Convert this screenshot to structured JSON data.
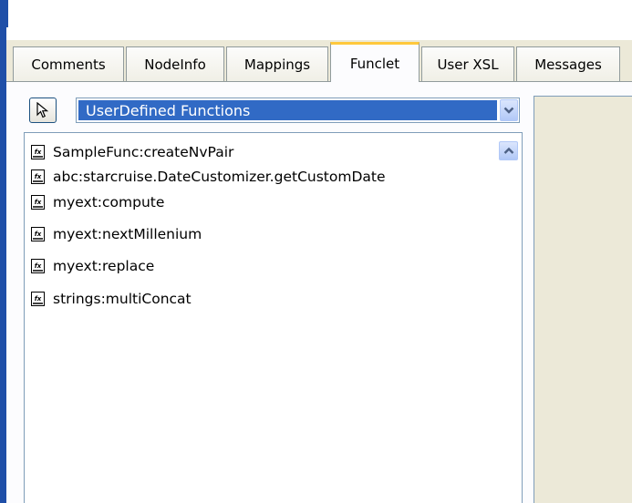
{
  "tabs": [
    {
      "label": "Comments"
    },
    {
      "label": "NodeInfo"
    },
    {
      "label": "Mappings"
    },
    {
      "label": "Funclet",
      "active": true
    },
    {
      "label": "User XSL"
    },
    {
      "label": "Messages"
    }
  ],
  "toolbar": {
    "select_tool_icon": "cursor-pointer-icon",
    "dropdown_value": "UserDefined Functions",
    "dropdown_arrow_icon": "chevron-down-icon"
  },
  "functions": [
    {
      "label": "SampleFunc:createNvPair",
      "icon": "function-fx-icon"
    },
    {
      "label": "abc:starcruise.DateCustomizer.getCustomDate",
      "icon": "function-fx-icon"
    },
    {
      "label": "myext:compute",
      "icon": "function-fx-icon"
    },
    {
      "label": "myext:nextMillenium",
      "icon": "function-fx-icon"
    },
    {
      "label": "myext:replace",
      "icon": "function-fx-icon"
    },
    {
      "label": "strings:multiConcat",
      "icon": "function-fx-icon"
    }
  ],
  "colors": {
    "active_tab_accent": "#ffc83c",
    "selection": "#316ac5",
    "window_bg": "#ece9d8",
    "side_bar": "#1f4fa8"
  }
}
